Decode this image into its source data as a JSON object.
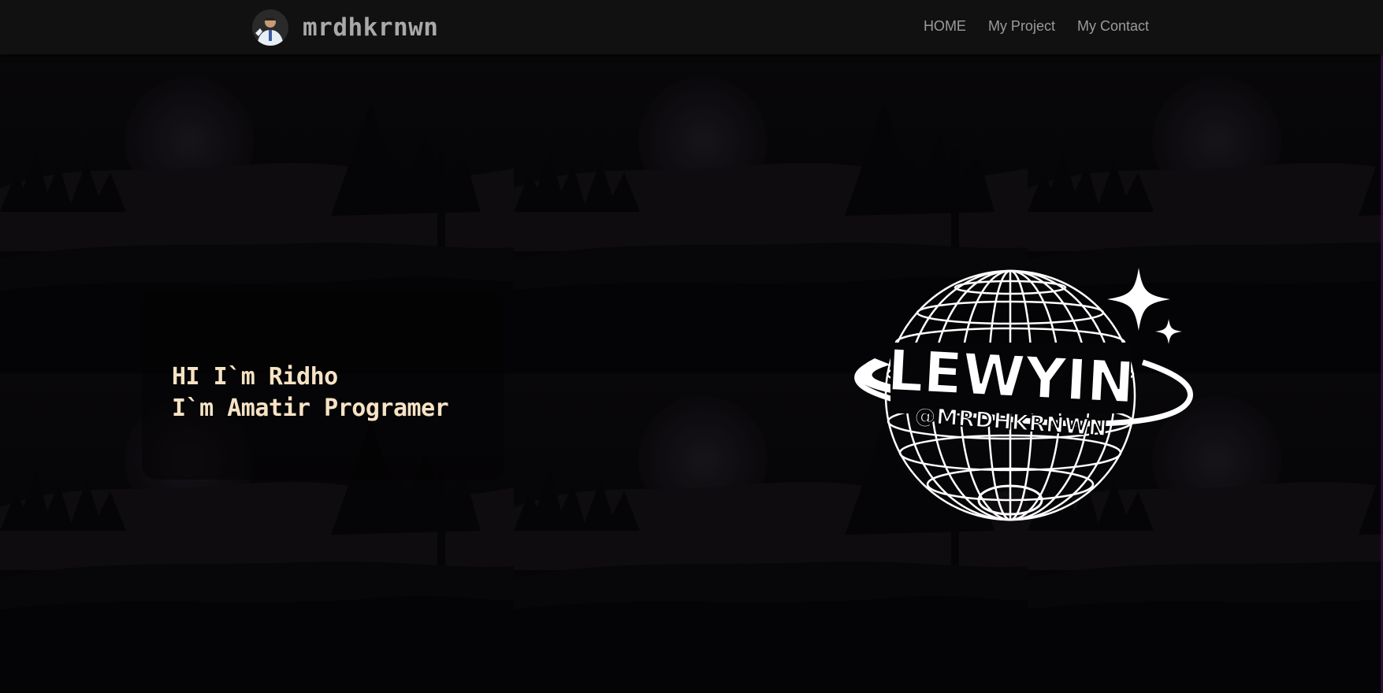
{
  "navbar": {
    "brand": "mrdhkrnwn",
    "avatar_icon": "avatar-photo",
    "links": [
      {
        "label": "HOME"
      },
      {
        "label": "My Project"
      },
      {
        "label": "My Contact"
      }
    ]
  },
  "hero": {
    "line1": "HI I`m Ridho",
    "line2": "I`m Amatir Programer",
    "logo": {
      "title": "LEWYIN",
      "handle": "@MRDHKRNWN",
      "icon": "globe-logo"
    }
  },
  "colors": {
    "navbar_bg": "#111111",
    "brand_text": "#a9a9a9",
    "nav_link": "#9b9b9b",
    "hero_text": "#f6e3c4",
    "hero_bg": "#060508"
  }
}
